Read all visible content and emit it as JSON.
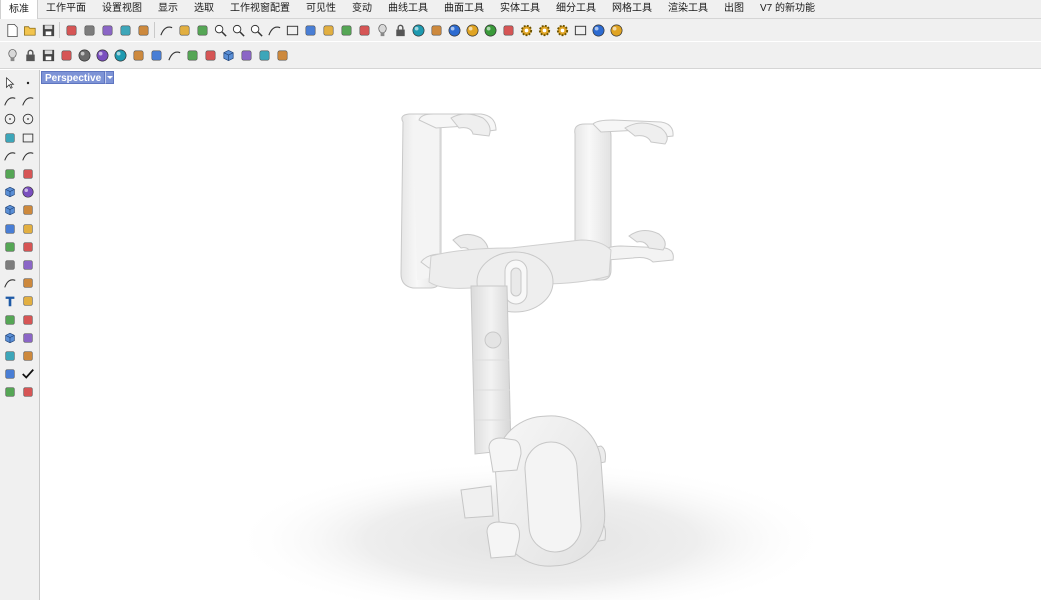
{
  "tabs": [
    {
      "label": "标准",
      "active": true
    },
    {
      "label": "工作平面"
    },
    {
      "label": "设置视图"
    },
    {
      "label": "显示"
    },
    {
      "label": "选取"
    },
    {
      "label": "工作视窗配置"
    },
    {
      "label": "可见性"
    },
    {
      "label": "变动"
    },
    {
      "label": "曲线工具"
    },
    {
      "label": "曲面工具"
    },
    {
      "label": "实体工具"
    },
    {
      "label": "细分工具"
    },
    {
      "label": "网格工具"
    },
    {
      "label": "渲染工具"
    },
    {
      "label": "出图"
    },
    {
      "label": "V7 的新功能"
    }
  ],
  "toolbar_row1": [
    "new-icon",
    "open-icon",
    "save-icon",
    "print-icon",
    "import-icon",
    "cut-icon",
    "copy-icon",
    "paste-icon",
    "undo-icon",
    "pan-icon",
    "rotate-view-icon",
    "zoom-icon",
    "zoom-window-icon",
    "zoom-extents-icon",
    "undo-view-icon",
    "four-viewports-icon",
    "car-icon",
    "hide-icon",
    "show-icon",
    "select-icon",
    "light-bulb-icon",
    "lock-icon",
    "color-wheel-icon",
    "shade-icon",
    "render-sphere-icon",
    "sphere-icon",
    "blue-sphere-icon",
    "gumball-icon",
    "gear-icon",
    "gear-yellow-icon",
    "gear-group-icon",
    "layout-icon",
    "globe-icon",
    "help-icon"
  ],
  "toolbar_row2": [
    "light-bulb-icon",
    "lock-icon",
    "save-small-icon",
    "bounding-icon",
    "shaded-sphere-icon",
    "rendered-sphere-icon",
    "color-circle-icon",
    "transform-icon",
    "arrows-icon",
    "curve-icon",
    "blend-icon",
    "cplane-icon",
    "box-edit-icon",
    "layer-icon",
    "eraser-icon",
    "dimension-icon"
  ],
  "left_toolbar": [
    [
      "select-arrow-icon",
      "point-icon"
    ],
    [
      "polyline-icon",
      "curve-cp-icon"
    ],
    [
      "circle-icon",
      "ellipse-icon"
    ],
    [
      "polygon-icon",
      "rectangle-icon"
    ],
    [
      "arc-icon",
      "fillet-curve-icon"
    ],
    [
      "surface-icon",
      "revolve-icon"
    ],
    [
      "box-solid-icon",
      "sphere-solid-icon"
    ],
    [
      "cylinder-icon",
      "extrude-icon"
    ],
    [
      "boolean-icon",
      "explode-icon"
    ],
    [
      "trim-icon",
      "split-icon"
    ],
    [
      "bucket-icon",
      "group-icon"
    ],
    [
      "curve-tool-icon",
      "offset-icon"
    ],
    [
      "text-icon",
      "dimension-icon"
    ],
    [
      "array-icon",
      "mirror-icon"
    ],
    [
      "mesh-box-icon",
      "ruler-icon"
    ],
    [
      "grid-array-icon",
      "snap-icon"
    ],
    [
      "analyze-icon",
      "check-icon"
    ],
    [
      "render-icon",
      "paint-icon"
    ]
  ],
  "viewport": {
    "title": "Perspective"
  },
  "colors": {
    "ui_bg": "#f0f0f0",
    "viewport_label_bg": "#7d93d6",
    "model_base": "#f2f2f2"
  }
}
